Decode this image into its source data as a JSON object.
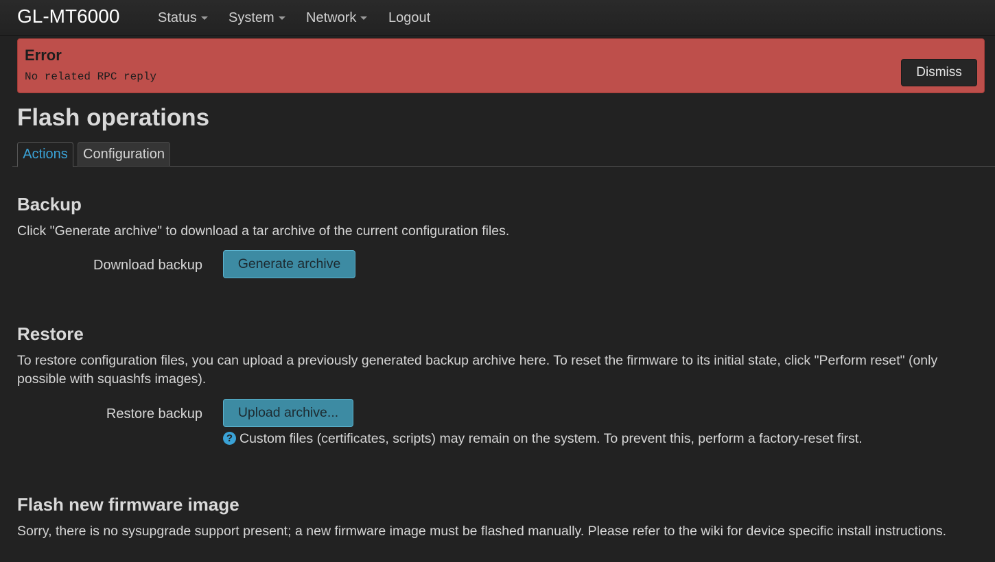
{
  "navbar": {
    "brand": "GL-MT6000",
    "items": [
      {
        "label": "Status",
        "dropdown": true
      },
      {
        "label": "System",
        "dropdown": true
      },
      {
        "label": "Network",
        "dropdown": true
      },
      {
        "label": "Logout",
        "dropdown": false
      }
    ]
  },
  "alert": {
    "title": "Error",
    "message": "No related RPC reply",
    "dismiss_label": "Dismiss",
    "color": "#be4f4b"
  },
  "page": {
    "title": "Flash operations",
    "tabs": [
      {
        "label": "Actions",
        "active": true
      },
      {
        "label": "Configuration",
        "active": false
      }
    ]
  },
  "backup": {
    "title": "Backup",
    "description": "Click \"Generate archive\" to download a tar archive of the current configuration files.",
    "field_label": "Download backup",
    "button_label": "Generate archive"
  },
  "restore": {
    "title": "Restore",
    "description": "To restore configuration files, you can upload a previously generated backup archive here. To reset the firmware to its initial state, click \"Perform reset\" (only possible with squashfs images).",
    "field_label": "Restore backup",
    "button_label": "Upload archive...",
    "help_icon": "question-circle-icon",
    "help_text": "Custom files (certificates, scripts) may remain on the system. To prevent this, perform a factory-reset first."
  },
  "firmware": {
    "title": "Flash new firmware image",
    "description": "Sorry, there is no sysupgrade support present; a new firmware image must be flashed manually. Please refer to the wiki for device specific install instructions."
  },
  "colors": {
    "background": "#222222",
    "accent": "#3aa2d6",
    "button": "#3d8ba3"
  }
}
